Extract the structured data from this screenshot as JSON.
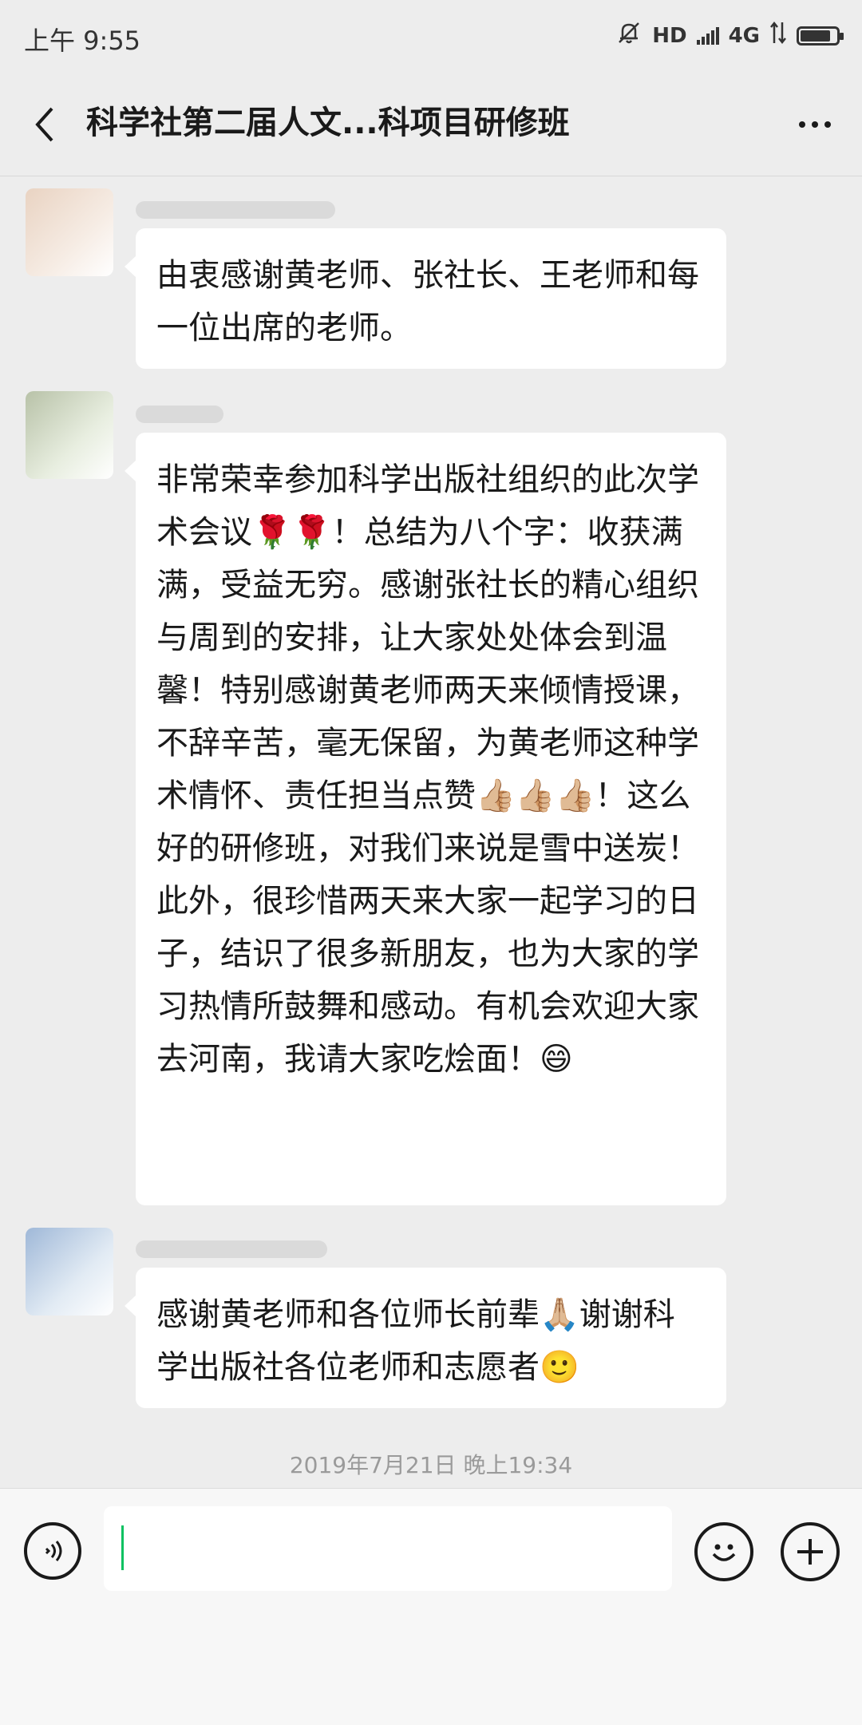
{
  "status_bar": {
    "time": "上午 9:55",
    "network_labels": [
      "HD",
      "4G"
    ],
    "icons": [
      "mute-bell-icon",
      "signal-icon",
      "data-arrows-icon",
      "battery-icon"
    ],
    "battery_level": 0.85
  },
  "header": {
    "title": "科学社第二届人文...科项目研修班",
    "back_icon": "chevron-left-icon",
    "more_icon": "ellipsis-icon"
  },
  "messages": [
    {
      "sender": "",
      "text": "由衷感谢黄老师、张社长、王老师和每一位出席的老师。"
    },
    {
      "sender": "",
      "text": "非常荣幸参加科学出版社组织的此次学术会议🌹🌹！总结为八个字：收获满满，受益无穷。感谢张社长的精心组织与周到的安排，让大家处处体会到温馨！特别感谢黄老师两天来倾情授课，不辞辛苦，毫无保留，为黄老师这种学术情怀、责任担当点赞👍🏼👍🏼👍🏼！这么好的研修班，对我们来说是雪中送炭！此外，很珍惜两天来大家一起学习的日子，结识了很多新朋友，也为大家的学习热情所鼓舞和感动。有机会欢迎大家去河南，我请大家吃烩面！😄"
    },
    {
      "sender": "",
      "text": "感谢黄老师和各位师长前辈🙏🏼谢谢科学出版社各位老师和志愿者🙂"
    }
  ],
  "timestamp": "2019年7月21日 晚上19:34",
  "input_bar": {
    "value": "",
    "voice_icon": "voice-icon",
    "emoji_icon": "emoji-icon",
    "plus_icon": "plus-icon"
  },
  "colors": {
    "background": "#ededed",
    "bubble": "#ffffff",
    "caret": "#07c160"
  }
}
